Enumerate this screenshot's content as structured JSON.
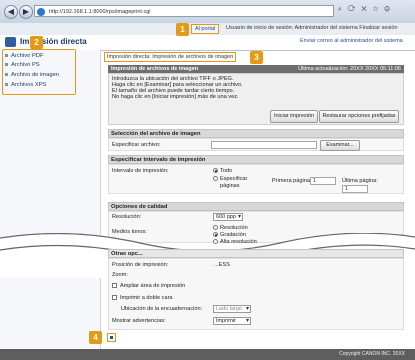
{
  "browser": {
    "url": "http://192.168.1.1:8000/rps/imageprint.cgi",
    "back_icon": "back-arrow-icon",
    "forward_icon": "forward-arrow-icon"
  },
  "header": {
    "app_title": "Impresión directa",
    "portal_label": "Al portal",
    "user_info": "Usuario de inicio de sesión: Administrador del sistema  Finalizar sesión",
    "send_admin": "Enviar correo al administrador del sistema"
  },
  "sidebar": {
    "items": [
      {
        "label": "Archivo PDF"
      },
      {
        "label": "Archivo PS"
      },
      {
        "label": "Archivo de imagen"
      },
      {
        "label": "Archivos XPS"
      }
    ]
  },
  "main": {
    "breadcrumb": "Impresión directa: Impresión de archivos de imagen",
    "panel_title": "Impresión de archivos de imagen",
    "last_updated": "Última actualización: 20XX 20XX 05:11:06",
    "instructions": [
      "Introduzca la ubicación del archivo TIFF o JPEG.",
      "Haga clic en [Examinar] para seleccionar un archivo.",
      "El tamaño del archivo puede tardar cierto tiempo.",
      "No haga clic en [Iniciar impresión] más de una vez."
    ],
    "start_print_btn": "Iniciar impresión",
    "restore_btn": "Restaurar opciones prefijadas",
    "sec_file": "Selección del archivo de imagen",
    "file_label": "Especificar archivo:",
    "browse_btn": "Examinar...",
    "sec_range": "Especificar intervalo de impresión",
    "range_label": "Intervalo de impresión:",
    "range_all": "Todo",
    "range_specify": "Especificar páginas",
    "first_page": "Primera página:",
    "first_value": "1",
    "last_page": "Última página:",
    "last_value": "1",
    "sec_quality": "Opciones de calidad",
    "resolution_label": "Resolución:",
    "resolution_value": "600 ppp",
    "halftone_label": "Medios tonos:",
    "halftone_opts": [
      "Resolución",
      "Gradación",
      "Alta resolución"
    ],
    "sec_other": "Otras opc...",
    "print_pos_label": "Posición de impresión:",
    "print_pos_value": "...ESS",
    "zoom_label": "Zoom:",
    "enlarge_area": "Ampliar área de impresión",
    "duplex": "Imprimir a doble cara",
    "binding_label": "Ubicación de la encuadernación:",
    "binding_value": "Lado largo",
    "warnings_label": "Mostrar advertencias:",
    "warnings_value": "Imprimir"
  },
  "footer": {
    "copyright": "Copyright CANON INC. 20XX"
  },
  "badges": [
    "1",
    "2",
    "3",
    "4"
  ],
  "colors": {
    "accent": "#e49a17",
    "header_dark": "#6e6e6e",
    "link": "#203c6a"
  }
}
